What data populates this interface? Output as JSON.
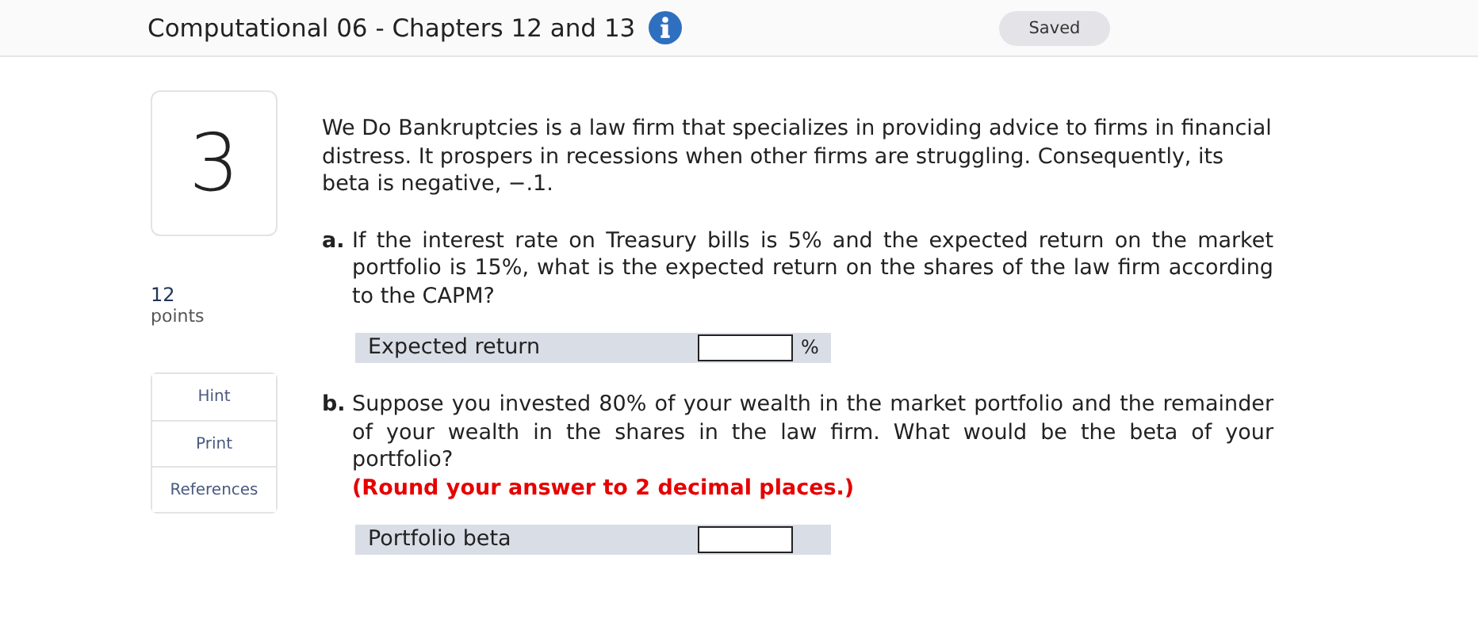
{
  "header": {
    "title": "Computational 06 - Chapters 12 and 13",
    "status": "Saved"
  },
  "question": {
    "number": "3",
    "points": "12",
    "points_label": "points"
  },
  "tools": [
    "Hint",
    "Print",
    "References"
  ],
  "intro": "We Do Bankruptcies is a law firm that specializes in providing advice to firms in financial distress. It prospers in recessions when other firms are struggling. Consequently, its beta is negative, −.1.",
  "parts": [
    {
      "letter": "a.",
      "text": "If the interest rate on Treasury bills is 5% and the expected return on the market portfolio is 15%, what is the expected return on the shares of the law firm according to the CAPM?",
      "answer": {
        "label": "Expected return",
        "unit": "%"
      }
    },
    {
      "letter": "b.",
      "text": "Suppose you invested 80% of your wealth in the market portfolio and the remainder of your wealth in the shares in the law firm. What would be the beta of your portfolio?",
      "note": "(Round your answer to 2 decimal places.)",
      "answer": {
        "label": "Portfolio beta"
      }
    }
  ]
}
